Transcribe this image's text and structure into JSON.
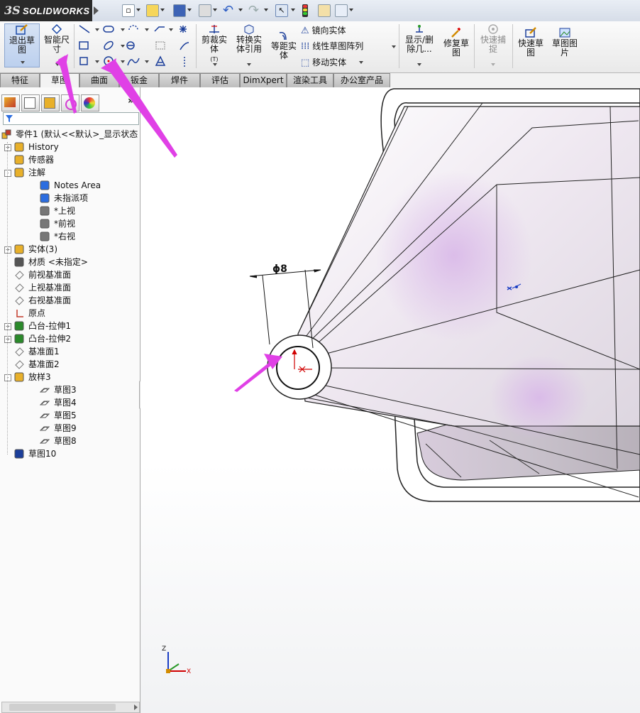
{
  "app": {
    "brand_prefix": "3S",
    "brand_name": "SOLIDWORKS"
  },
  "quickbar": {
    "icons": [
      "new-icon",
      "open-icon",
      "save-icon",
      "print-icon",
      "undo-icon",
      "redo-icon",
      "select-icon",
      "rebuild-icon",
      "options-icon",
      "customize-icon"
    ]
  },
  "ribbon": {
    "exit_sketch": "退出草图",
    "smart_dimension": "智能尺寸",
    "trim": "剪裁实体",
    "trim_suffix": "(T)",
    "convert": "转换实体引用",
    "offset": "等距实体",
    "mirror": "镜向实体",
    "linear_pattern": "线性草图阵列",
    "move": "移动实体",
    "show_delete": "显示/删除几...",
    "repair": "修复草图",
    "quick_snap": "快速捕捉",
    "rapid_sketch": "快速草图",
    "sketch_picture": "草图图片"
  },
  "tabs": [
    "特征",
    "草图",
    "曲面",
    "钣金",
    "焊件",
    "评估",
    "DimXpert",
    "渲染工具",
    "办公室产品"
  ],
  "tree": {
    "root": "零件1  (默认<<默认>_显示状态",
    "items": [
      {
        "label": "History",
        "icon": "history-icon",
        "level": 1,
        "expand": "+"
      },
      {
        "label": "传感器",
        "icon": "sensor-icon",
        "level": 1,
        "expand": ""
      },
      {
        "label": "注解",
        "icon": "annotation-icon",
        "level": 1,
        "expand": "-"
      },
      {
        "label": "Notes Area",
        "icon": "notes-area-icon",
        "level": 2,
        "expand": ""
      },
      {
        "label": "未指派项",
        "icon": "unassigned-icon",
        "level": 2,
        "expand": ""
      },
      {
        "label": "*上视",
        "icon": "view-top-icon",
        "level": 2,
        "expand": ""
      },
      {
        "label": "*前视",
        "icon": "view-front-icon",
        "level": 2,
        "expand": ""
      },
      {
        "label": "*右视",
        "icon": "view-right-icon",
        "level": 2,
        "expand": ""
      },
      {
        "label": "实体(3)",
        "icon": "solid-bodies-icon",
        "level": 1,
        "expand": "+"
      },
      {
        "label": "材质 <未指定>",
        "icon": "material-icon",
        "level": 1,
        "expand": ""
      },
      {
        "label": "前视基准面",
        "icon": "plane-icon",
        "level": 1,
        "expand": ""
      },
      {
        "label": "上视基准面",
        "icon": "plane-icon",
        "level": 1,
        "expand": ""
      },
      {
        "label": "右视基准面",
        "icon": "plane-icon",
        "level": 1,
        "expand": ""
      },
      {
        "label": "原点",
        "icon": "origin-icon",
        "level": 1,
        "expand": ""
      },
      {
        "label": "凸台-拉伸1",
        "icon": "extrude-icon",
        "level": 1,
        "expand": "+"
      },
      {
        "label": "凸台-拉伸2",
        "icon": "extrude-icon",
        "level": 1,
        "expand": "+"
      },
      {
        "label": "基准面1",
        "icon": "plane-icon",
        "level": 1,
        "expand": ""
      },
      {
        "label": "基准面2",
        "icon": "plane-icon",
        "level": 1,
        "expand": ""
      },
      {
        "label": "放样3",
        "icon": "loft-icon",
        "level": 1,
        "expand": "-"
      },
      {
        "label": "草图3",
        "icon": "sketch-icon",
        "level": 2,
        "expand": ""
      },
      {
        "label": "草图4",
        "icon": "sketch-icon",
        "level": 2,
        "expand": ""
      },
      {
        "label": "草图5",
        "icon": "sketch-icon",
        "level": 2,
        "expand": ""
      },
      {
        "label": "草图9",
        "icon": "sketch-icon",
        "level": 2,
        "expand": ""
      },
      {
        "label": "草图8",
        "icon": "sketch-icon",
        "level": 2,
        "expand": ""
      },
      {
        "label": "草图10",
        "icon": "active-sketch-icon",
        "level": 1,
        "expand": ""
      }
    ]
  },
  "viewport": {
    "dimension_label": "ϕ8",
    "triad": {
      "z": "Z",
      "x": "X"
    }
  },
  "colors": {
    "annotation_arrow": "#e040e6",
    "selection": "#d00000"
  }
}
